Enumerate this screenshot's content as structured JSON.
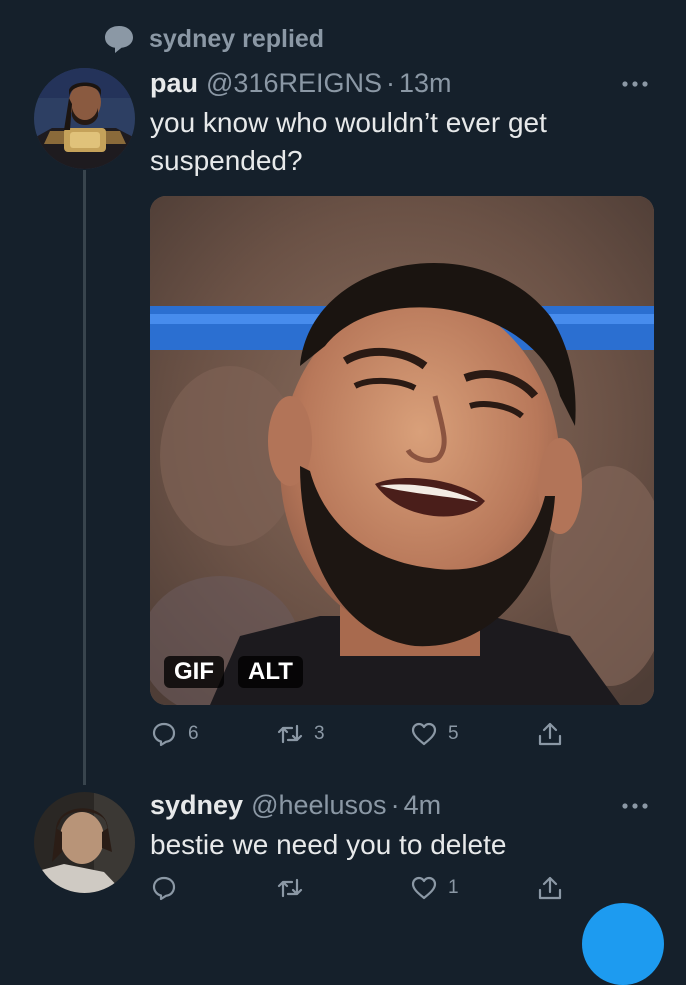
{
  "context": {
    "icon": "speech-bubble-icon",
    "text": "sydney replied"
  },
  "tweets": [
    {
      "name": "pau",
      "handle": "@316REIGNS",
      "separator": "·",
      "time": "13m",
      "text": "you know who wouldn’t ever get suspended?",
      "media": {
        "badges": [
          "GIF",
          "ALT"
        ]
      },
      "actions": {
        "replies": "6",
        "retweets": "3",
        "likes": "5"
      }
    },
    {
      "name": "sydney",
      "handle": "@heelusos",
      "separator": "·",
      "time": "4m",
      "text": "bestie we need you to delete",
      "actions": {
        "replies": "",
        "retweets": "",
        "likes": "1"
      }
    }
  ],
  "colors": {
    "background": "#15202b",
    "secondary_text": "#8b98a5",
    "primary_text": "#e7e9ea",
    "accent": "#1d9bf0"
  }
}
